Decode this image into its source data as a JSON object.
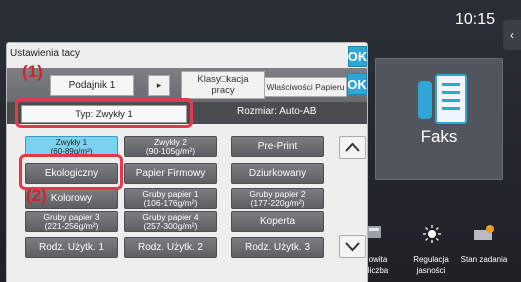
{
  "clock": "10:15",
  "home": {
    "fax_tile_label": "Faks",
    "bottom": [
      {
        "label": "owita\nliczba",
        "icon": "counter-icon"
      },
      {
        "label": "Regulacja\njasności",
        "icon": "brightness-icon"
      },
      {
        "label": "Stan zadania",
        "icon": "job-status-icon"
      }
    ]
  },
  "dialog": {
    "title": "Ustawienia tacy",
    "ok": "OK",
    "tray": "Podajnik 1",
    "tabs": {
      "classify": "Klasy□kacja\npracy",
      "properties": "Właściwości Papieru"
    },
    "type_label": "Typ:  Zwykły 1",
    "size_label": "Rozmiar:  Auto-AB",
    "paper_types": [
      [
        "Zwykły 1\n(60-89g/m²)",
        "Zwykły 2\n(90-105g/m²)",
        "Pre-Print"
      ],
      [
        "Ekologiczny",
        "Papier Firmowy",
        "Dziurkowany"
      ],
      [
        "Kolorowy",
        "Gruby papier 1\n(106-176g/m²)",
        "Gruby papier 2\n(177-220g/m²)"
      ],
      [
        "Gruby papier 3\n(221-256g/m²)",
        "Gruby papier 4\n(257-300g/m²)",
        "Koperta"
      ],
      [
        "Rodz. Użytk. 1",
        "Rodz. Użytk. 2",
        "Rodz. Użytk. 3"
      ]
    ]
  },
  "callouts": [
    "(1)",
    "(2)"
  ],
  "colors": {
    "accent": "#2ea6d8",
    "selected": "#7cd2ee",
    "callout": "#d4202c"
  }
}
